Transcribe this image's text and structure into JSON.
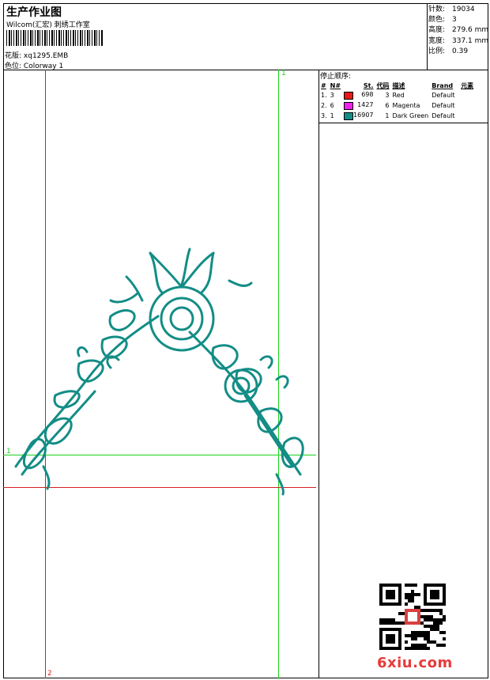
{
  "header": {
    "title": "生产作业图",
    "subtitle": "Wilcom(汇宏) 刺绣工作室",
    "design_label": "花版:",
    "design_value": "xq1295.EMB",
    "colorway_label": "色位:",
    "colorway_value": "Colorway 1"
  },
  "stats": [
    {
      "label": "针数:",
      "value": "19034"
    },
    {
      "label": "颜色:",
      "value": "3"
    },
    {
      "label": "高度:",
      "value": "279.6 mm"
    },
    {
      "label": "宽度:",
      "value": "337.1 mm"
    },
    {
      "label": "比例:",
      "value": "0.39"
    }
  ],
  "stop_sequence": {
    "title": "停止顺序:",
    "headers": [
      "#",
      "N#",
      "St.",
      "代码",
      "描述",
      "Brand",
      "元素"
    ],
    "rows": [
      {
        "index": "1.",
        "needle": "3",
        "color": "#e8191b",
        "stitches": "698",
        "code": "3",
        "desc": "Red",
        "brand": "Default"
      },
      {
        "index": "2.",
        "needle": "6",
        "color": "#ee22ee",
        "stitches": "1427",
        "code": "6",
        "desc": "Magenta",
        "brand": "Default"
      },
      {
        "index": "3.",
        "needle": "1",
        "color": "#138d86",
        "stitches": "16907",
        "code": "1",
        "desc": "Dark Green",
        "brand": "Default"
      }
    ]
  },
  "guides": {
    "green_label": "1",
    "red_label": "2",
    "green_color": "#19d219",
    "red_color": "#d62020"
  },
  "design": {
    "thread_color": "#138d86"
  },
  "watermark": "6xiu.com"
}
